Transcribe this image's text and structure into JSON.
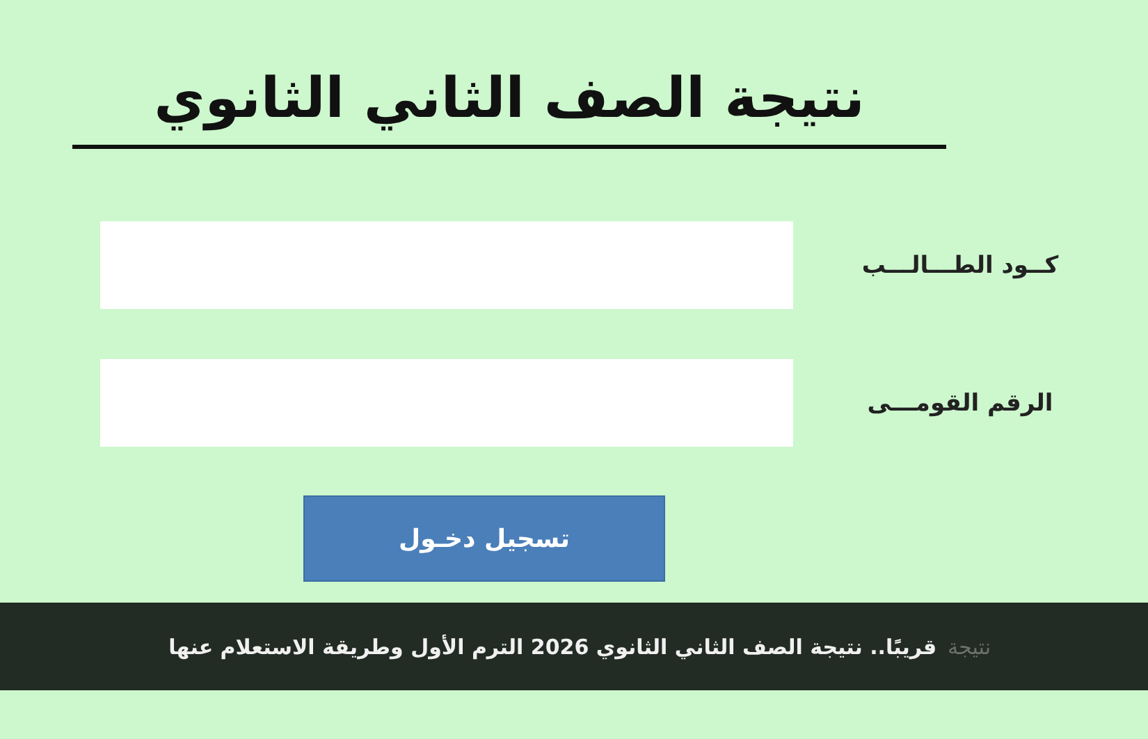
{
  "title": "نتيجة الصف الثاني الثانوي",
  "fields": [
    {
      "label": "كــود الطـــالـــب"
    },
    {
      "label": "الرقم القومـــى"
    }
  ],
  "submit_button": "تسجيل دخـول",
  "ticker": {
    "tag": "نتيجة",
    "headline": "قريبًا.. نتيجة الصف الثاني الثانوي 2026 الترم الأول وطريقة الاستعلام عنها"
  }
}
